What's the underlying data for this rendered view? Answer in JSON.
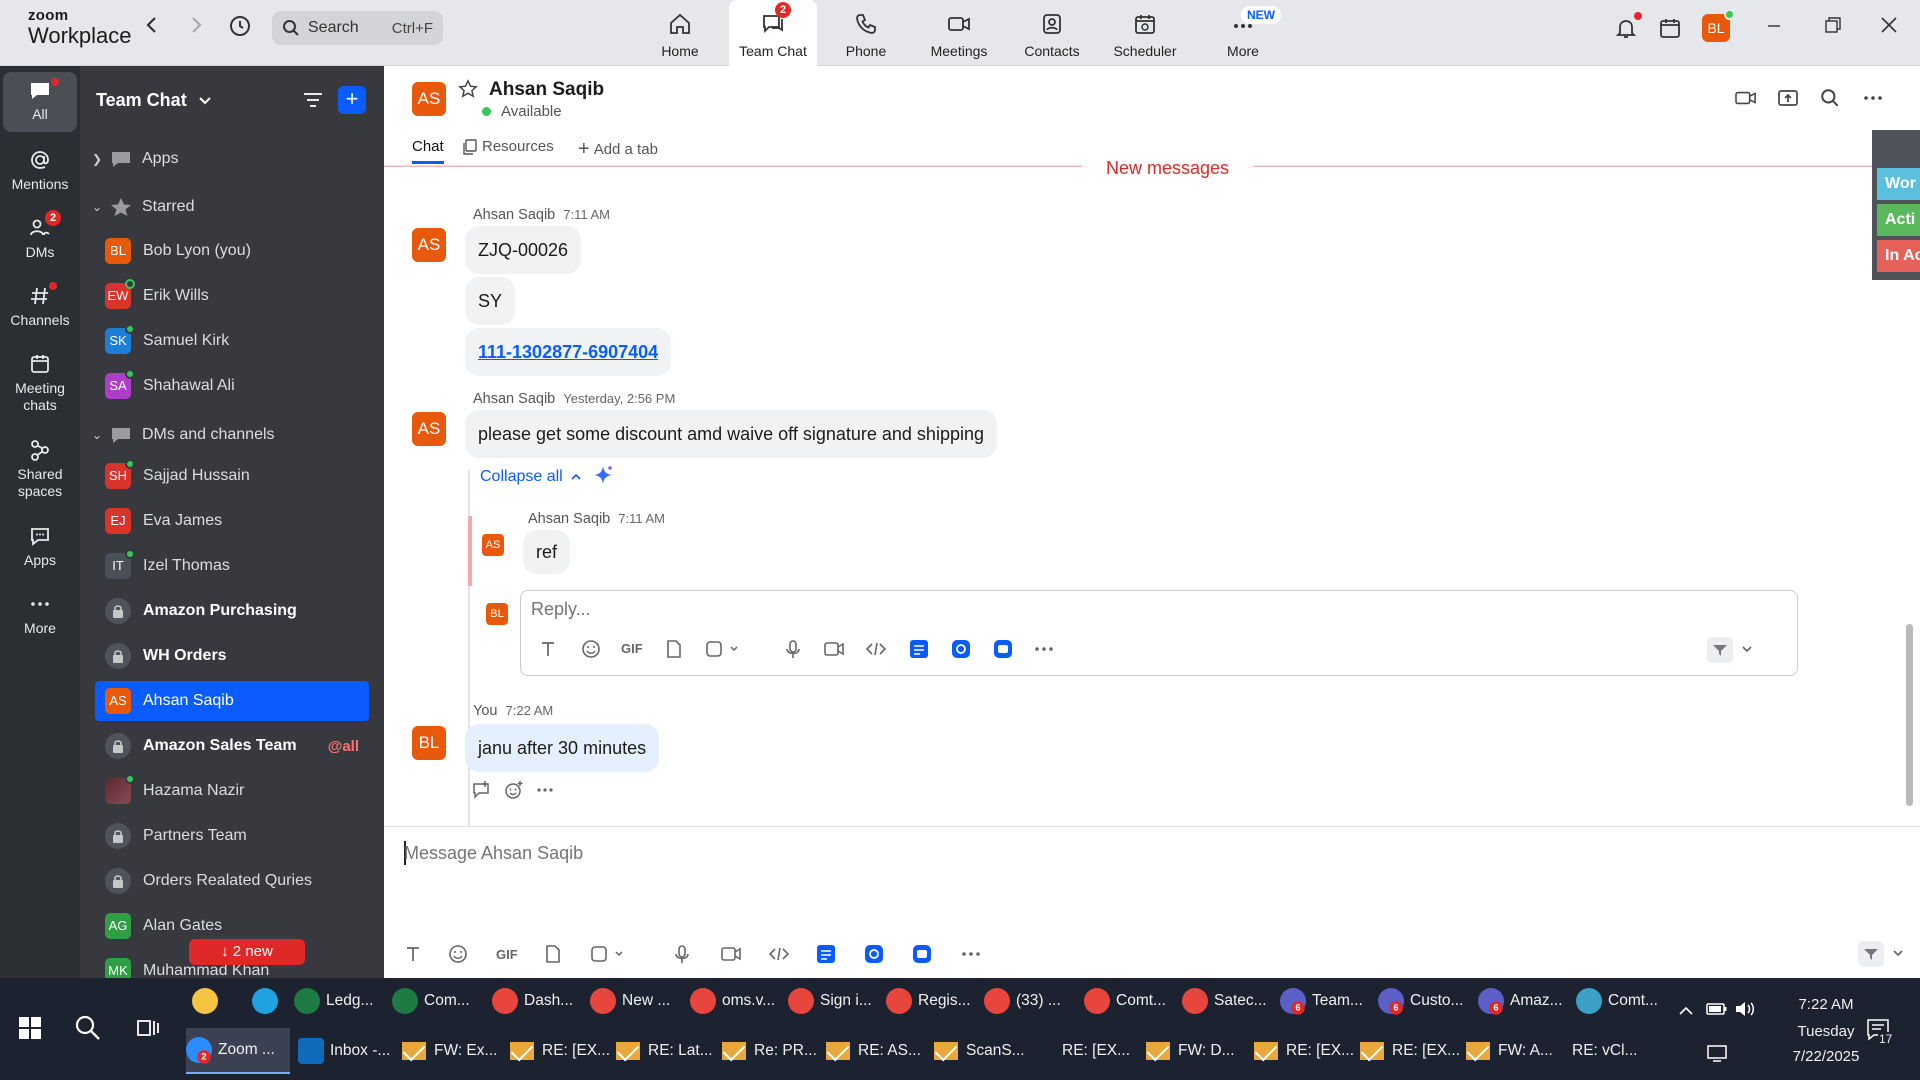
{
  "app": {
    "logo_line1": "zoom",
    "logo_line2": "Workplace",
    "search_label": "Search",
    "search_shortcut": "Ctrl+F",
    "tabs": [
      {
        "label": "Home",
        "icon": "home-icon"
      },
      {
        "label": "Team Chat",
        "icon": "chat-icon",
        "badge": "2",
        "active": true
      },
      {
        "label": "Phone",
        "icon": "phone-icon"
      },
      {
        "label": "Meetings",
        "icon": "video-icon"
      },
      {
        "label": "Contacts",
        "icon": "contacts-icon"
      },
      {
        "label": "Scheduler",
        "icon": "calendar-icon"
      },
      {
        "label": "More",
        "icon": "more-icon",
        "badge_new": "NEW"
      }
    ],
    "user_initials": "BL",
    "accent": "#0b5cff"
  },
  "rail": {
    "items": [
      {
        "label": "All"
      },
      {
        "label": "Mentions"
      },
      {
        "label": "DMs",
        "badge": "2"
      },
      {
        "label": "Channels"
      },
      {
        "label": "Meeting chats"
      },
      {
        "label": "Shared spaces"
      },
      {
        "label": "Apps"
      },
      {
        "label": "More"
      }
    ]
  },
  "sidebar": {
    "title": "Team Chat",
    "sections": [
      {
        "label": "Apps"
      },
      {
        "label": "Starred"
      },
      {
        "label": "DMs and channels"
      }
    ],
    "starred": [
      {
        "initials": "BL",
        "name": "Bob Lyon (you)",
        "color": "#e8590c"
      },
      {
        "initials": "EW",
        "name": "Erik Wills",
        "color": "#d9342b"
      },
      {
        "initials": "SK",
        "name": "Samuel Kirk",
        "color": "#1c7ed6"
      },
      {
        "initials": "SA",
        "name": "Shahawal Ali",
        "color": "#ae3ec9"
      }
    ],
    "dms": [
      {
        "initials": "SH",
        "name": "Sajjad Hussain",
        "color": "#d9342b"
      },
      {
        "initials": "EJ",
        "name": "Eva James",
        "color": "#d9342b"
      },
      {
        "initials": "IT",
        "name": "Izel Thomas",
        "color": "#495057"
      },
      {
        "name": "Amazon Purchasing",
        "bold": true,
        "lock": true
      },
      {
        "name": "WH Orders",
        "bold": true,
        "lock": true
      },
      {
        "initials": "AS",
        "name": "Ahsan Saqib",
        "color": "#e8590c",
        "selected": true
      },
      {
        "name": "Amazon Sales Team",
        "bold": true,
        "lock": true,
        "mention": "@all"
      },
      {
        "name": "Hazama Nazir",
        "photo": true
      },
      {
        "name": "Partners Team",
        "lock": true
      },
      {
        "name": "Orders Realated Quries",
        "lock": true
      },
      {
        "initials": "AG",
        "name": "Alan Gates",
        "color": "#2f9e44"
      },
      {
        "initials": "MK",
        "name": "Muhammad Khan",
        "color": "#2f9e44"
      }
    ],
    "new_pill": "↓ 2 new"
  },
  "chat": {
    "contact_initials": "AS",
    "contact_name": "Ahsan Saqib",
    "contact_status": "Available",
    "tabs": [
      "Chat",
      "Resources",
      "Add a tab"
    ],
    "new_messages_label": "New messages",
    "messages": [
      {
        "author": "Ahsan Saqib",
        "time": "7:11 AM",
        "bubbles": [
          "ZJQ-00026",
          "SY",
          "111-1302877-6907404"
        ]
      },
      {
        "author": "Ahsan Saqib",
        "time": "Yesterday, 2:56 PM",
        "bubbles": [
          "please get some discount amd waive off signature and shipping"
        ]
      }
    ],
    "collapse_label": "Collapse all",
    "thread_reply": {
      "author": "Ahsan Saqib",
      "time": "7:11 AM",
      "text": "ref",
      "initials": "AS"
    },
    "reply_placeholder": "Reply...",
    "reply_avatar": "BL",
    "my_message": {
      "author": "You",
      "time": "7:22 AM",
      "text": "janu after 30 minutes",
      "initials": "BL"
    },
    "composer_placeholder": "Message Ahsan Saqib"
  },
  "edge": {
    "tags": [
      {
        "label": "Wor",
        "color": "#5bc0de"
      },
      {
        "label": "Acti",
        "color": "#5cb85c"
      },
      {
        "label": "In Ac",
        "color": "#e8605a"
      }
    ]
  },
  "taskbar": {
    "row1": [
      {
        "label": "",
        "icon": "file-explorer-icon",
        "color": "#f5c542"
      },
      {
        "label": "",
        "icon": "edge-icon",
        "color": "#1fa3e0"
      },
      {
        "label": "Ledg...",
        "icon": "excel-icon",
        "color": "#1d7a43"
      },
      {
        "label": "Com...",
        "icon": "excel-icon",
        "color": "#1d7a43"
      },
      {
        "label": "Dash...",
        "icon": "chrome-icon",
        "color": "#e8453c"
      },
      {
        "label": "New ...",
        "icon": "chrome-icon",
        "color": "#e8453c"
      },
      {
        "label": "oms.v...",
        "icon": "chrome-icon",
        "color": "#e8453c"
      },
      {
        "label": "Sign i...",
        "icon": "chrome-icon",
        "color": "#e8453c"
      },
      {
        "label": "Regis...",
        "icon": "chrome-icon",
        "color": "#e8453c"
      },
      {
        "label": "(33) ...",
        "icon": "chrome-icon",
        "color": "#e8453c"
      },
      {
        "label": "Comt...",
        "icon": "chrome-icon",
        "color": "#e8453c"
      },
      {
        "label": "Satec...",
        "icon": "chrome-icon",
        "color": "#e8453c"
      },
      {
        "label": "Team...",
        "icon": "teams-icon",
        "color": "#5b5fc7",
        "badge": "6"
      },
      {
        "label": "Custo...",
        "icon": "teams-icon",
        "color": "#5b5fc7",
        "badge": "6"
      },
      {
        "label": "Amaz...",
        "icon": "teams-icon",
        "color": "#5b5fc7",
        "badge": "6"
      },
      {
        "label": "Comt...",
        "icon": "app-icon",
        "color": "#3aa0c8"
      }
    ],
    "row2": [
      {
        "label": "Zoom ...",
        "icon": "zoom-icon",
        "color": "#2d8cff",
        "badge": "2",
        "active": true
      },
      {
        "label": "Inbox -...",
        "icon": "outlook-icon",
        "color": "#0f6cbd"
      },
      {
        "label": "FW: Ex..."
      },
      {
        "label": "RE: [EX..."
      },
      {
        "label": "RE: Lat..."
      },
      {
        "label": "Re: PR..."
      },
      {
        "label": "RE: AS..."
      },
      {
        "label": "ScanS..."
      },
      {
        "label": "RE: [EX..."
      },
      {
        "label": "FW: D..."
      },
      {
        "label": "RE: [EX..."
      },
      {
        "label": "RE: [EX..."
      },
      {
        "label": "FW: A..."
      },
      {
        "label": "RE: vCl..."
      }
    ],
    "clock_time": "7:22 AM",
    "clock_day": "Tuesday",
    "clock_date": "7/22/2025",
    "notif_count": "17"
  }
}
